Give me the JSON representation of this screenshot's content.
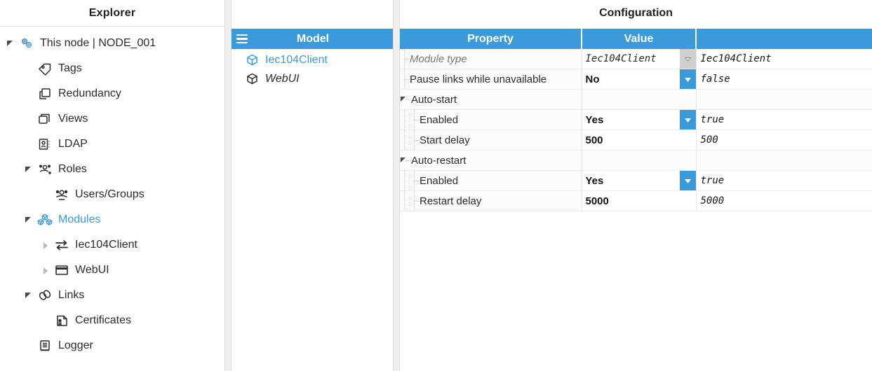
{
  "accent_color": "#3b9ada",
  "explorer": {
    "title": "Explorer",
    "items": [
      {
        "label": "This node | NODE_001",
        "icon": "gears-icon",
        "expander": "open",
        "indent": 0,
        "accent": false
      },
      {
        "label": "Tags",
        "icon": "tag-icon",
        "expander": "none",
        "indent": 1,
        "accent": false
      },
      {
        "label": "Redundancy",
        "icon": "copy-icon",
        "expander": "none",
        "indent": 1,
        "accent": false
      },
      {
        "label": "Views",
        "icon": "views-icon",
        "expander": "none",
        "indent": 1,
        "accent": false
      },
      {
        "label": "LDAP",
        "icon": "contact-card-icon",
        "expander": "none",
        "indent": 1,
        "accent": false
      },
      {
        "label": "Roles",
        "icon": "users-add-icon",
        "expander": "open",
        "indent": 1,
        "accent": false
      },
      {
        "label": "Users/Groups",
        "icon": "users-icon",
        "expander": "none",
        "indent": 2,
        "accent": false
      },
      {
        "label": "Modules",
        "icon": "modules-cubes-icon",
        "expander": "open",
        "indent": 1,
        "accent": true
      },
      {
        "label": "Iec104Client",
        "icon": "exchange-arrows-icon",
        "expander": "closed",
        "indent": 2,
        "accent": false
      },
      {
        "label": "WebUI",
        "icon": "window-icon",
        "expander": "closed",
        "indent": 2,
        "accent": false
      },
      {
        "label": "Links",
        "icon": "link-chain-icon",
        "expander": "open",
        "indent": 1,
        "accent": false
      },
      {
        "label": "Certificates",
        "icon": "certificate-icon",
        "expander": "none",
        "indent": 2,
        "accent": false
      },
      {
        "label": "Logger",
        "icon": "book-icon",
        "expander": "none",
        "indent": 1,
        "accent": false
      }
    ]
  },
  "model": {
    "header_title": "Model",
    "menu_icon": "hamburger-menu-icon",
    "items": [
      {
        "label": "Iec104Client",
        "icon": "cube-icon",
        "accent": true
      },
      {
        "label": "WebUI",
        "icon": "cube-icon",
        "accent": false
      }
    ]
  },
  "configuration": {
    "title": "Configuration",
    "columns": [
      "Property",
      "Value",
      ""
    ],
    "rows": [
      {
        "property": "Module type",
        "style": "readonly",
        "level": 1,
        "value": "Iec104Client",
        "value_mono": true,
        "dropdown": "dim",
        "raw": "Iec104Client"
      },
      {
        "property": "Pause links while unavailable",
        "style": "normal",
        "level": 1,
        "value": "No",
        "value_mono": false,
        "dropdown": "active",
        "raw": "false"
      },
      {
        "property": "Auto-start",
        "style": "group",
        "level": 0,
        "value": "",
        "value_mono": false,
        "dropdown": "none",
        "raw": ""
      },
      {
        "property": "Enabled",
        "style": "normal",
        "level": 2,
        "value": "Yes",
        "value_mono": false,
        "dropdown": "active",
        "raw": "true"
      },
      {
        "property": "Start delay",
        "style": "normal",
        "level": 2,
        "value": "500",
        "value_mono": false,
        "dropdown": "none",
        "raw": "500"
      },
      {
        "property": "Auto-restart",
        "style": "group",
        "level": 0,
        "value": "",
        "value_mono": false,
        "dropdown": "none",
        "raw": ""
      },
      {
        "property": "Enabled",
        "style": "normal",
        "level": 2,
        "value": "Yes",
        "value_mono": false,
        "dropdown": "active",
        "raw": "true"
      },
      {
        "property": "Restart delay",
        "style": "normal",
        "level": 2,
        "value": "5000",
        "value_mono": false,
        "dropdown": "none",
        "raw": "5000"
      }
    ]
  }
}
